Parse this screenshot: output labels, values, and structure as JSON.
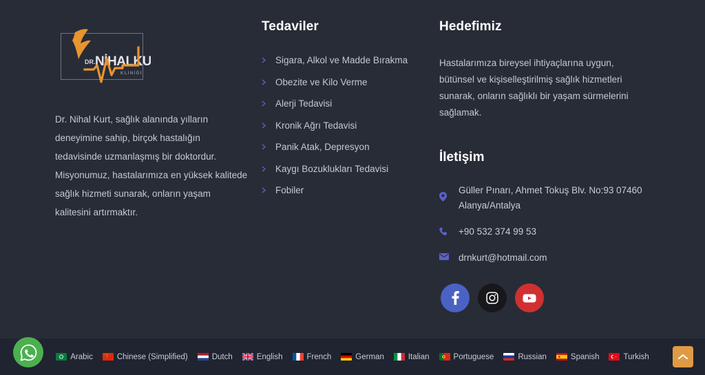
{
  "theme": {
    "background": "#282c37",
    "bottom_bar_background": "#1f2430",
    "heading_color": "#ffffff",
    "body_text_color": "#c4c8d2",
    "accent_bullet": "#5d62c4",
    "accent_icon": "#5b60cc",
    "logo_accent": "#e8942f",
    "scroll_top_background": "#e09a45",
    "whatsapp_background": "#4caf50"
  },
  "brand": {
    "logo_name": "clinic-logo",
    "logo_prefix": "DR.",
    "logo_title": "NİHALKURT",
    "logo_subtitle": "KLİNİĞİ",
    "description": "Dr. Nihal Kurt, sağlık alanında yılların deneyimine sahip, birçok hastalığın tedavisinde uzmanlaşmış bir doktordur. Misyonumuz, hastalarımıza en yüksek kalitede sağlık hizmeti sunarak, onların yaşam kalitesini artırmaktır."
  },
  "treatments": {
    "heading": "Tedaviler",
    "items": [
      {
        "label": "Sigara, Alkol ve Madde Bırakma"
      },
      {
        "label": "Obezite ve Kilo Verme"
      },
      {
        "label": "Alerji Tedavisi"
      },
      {
        "label": "Kronik Ağrı Tedavisi"
      },
      {
        "label": "Panik Atak, Depresyon"
      },
      {
        "label": "Kaygı Bozuklukları Tedavisi"
      },
      {
        "label": "Fobiler"
      }
    ]
  },
  "goal": {
    "heading": "Hedefimiz",
    "text": "Hastalarımıza bireysel ihtiyaçlarına uygun, bütünsel ve kişiselleştirilmiş sağlık hizmetleri sunarak, onların sağlıklı bir yaşam sürmelerini sağlamak."
  },
  "contact": {
    "heading": "İletişim",
    "items": [
      {
        "icon": "map-pin-icon",
        "text": "Güller Pınarı, Ahmet Tokuş Blv. No:93 07460\nAlanya/Antalya"
      },
      {
        "icon": "phone-icon",
        "text": "+90 532 374 99 53"
      },
      {
        "icon": "envelope-icon",
        "text": "drnkurt@hotmail.com"
      }
    ]
  },
  "social": [
    {
      "name": "facebook",
      "label": "Facebook",
      "color": "#4a62c4"
    },
    {
      "name": "instagram",
      "label": "Instagram",
      "color": "#18181c"
    },
    {
      "name": "youtube",
      "label": "YouTube",
      "color": "#d13030"
    }
  ],
  "languages": [
    {
      "label": "Arabic",
      "flag": "arabic-flag"
    },
    {
      "label": "Chinese (Simplified)",
      "flag": "chinese-flag"
    },
    {
      "label": "Dutch",
      "flag": "dutch-flag"
    },
    {
      "label": "English",
      "flag": "english-flag"
    },
    {
      "label": "French",
      "flag": "french-flag"
    },
    {
      "label": "German",
      "flag": "german-flag"
    },
    {
      "label": "Italian",
      "flag": "italian-flag"
    },
    {
      "label": "Portuguese",
      "flag": "portuguese-flag"
    },
    {
      "label": "Russian",
      "flag": "russian-flag"
    },
    {
      "label": "Spanish",
      "flag": "spanish-flag"
    },
    {
      "label": "Turkish",
      "flag": "turkish-flag"
    }
  ],
  "floating": {
    "whatsapp_label": "WhatsApp",
    "scroll_top_label": "Yukarı"
  }
}
